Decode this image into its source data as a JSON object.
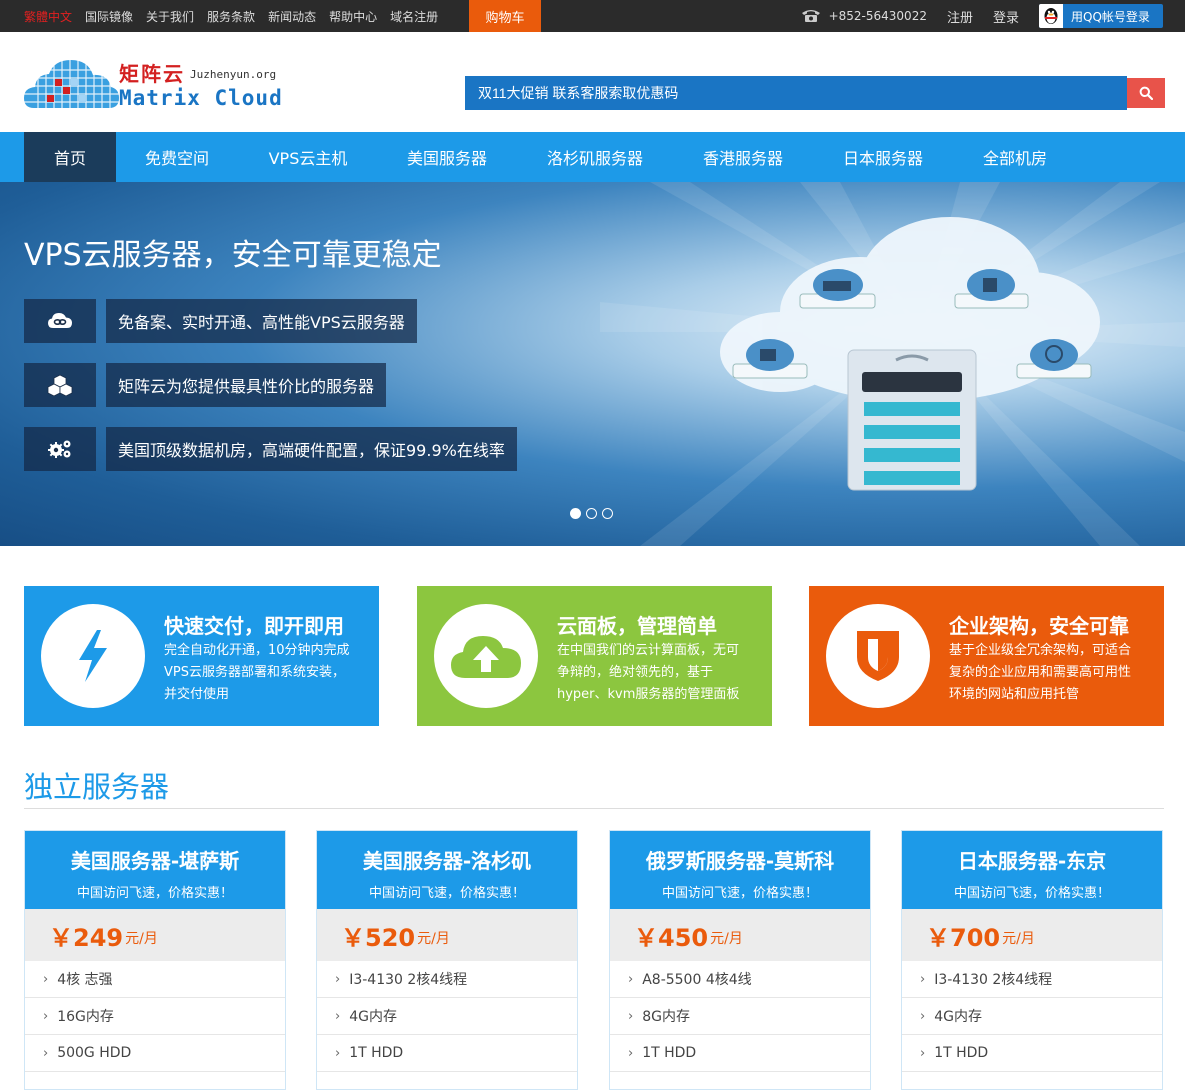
{
  "topbar": {
    "links": [
      "繁體中文",
      "国际镜像",
      "关于我们",
      "服务条款",
      "新闻动态",
      "帮助中心",
      "域名注册"
    ],
    "cart": "购物车",
    "phone": "+852-56430022",
    "register": "注册",
    "login": "登录",
    "qq_login": "用QQ帐号登录"
  },
  "logo": {
    "cn": "矩阵云",
    "domain": "Juzhenyun.org",
    "en": "Matrix Cloud"
  },
  "search": {
    "value": "双11大促销 联系客服索取优惠码"
  },
  "nav": {
    "items": [
      "首页",
      "免费空间",
      "VPS云主机",
      "美国服务器",
      "洛杉矶服务器",
      "香港服务器",
      "日本服务器",
      "全部机房"
    ]
  },
  "banner": {
    "title": "VPS云服务器，安全可靠更稳定",
    "features": [
      {
        "text": "免备案、实时开通、高性能VPS云服务器",
        "icon": "cloud-link-icon"
      },
      {
        "text": "矩阵云为您提供最具性价比的服务器",
        "icon": "cubes-icon"
      },
      {
        "text": "美国顶级数据机房，高端硬件配置，保证99.9%在线率",
        "icon": "gears-icon"
      }
    ],
    "active_slide": 1,
    "slides": 3
  },
  "boxes": [
    {
      "title": "快速交付，即开即用",
      "text": "完全自动化开通，10分钟内完成VPS云服务器部署和系统安装，并交付使用",
      "color": "#1d9ae8",
      "icon": "lightning-icon"
    },
    {
      "title": "云面板，管理简单",
      "text": "在中国我们的云计算面板，无可争辩的，绝对领先的，基于hyper、kvm服务器的管理面板",
      "color": "#8cc63f",
      "icon": "cloud-upload-icon"
    },
    {
      "title": "企业架构，安全可靠",
      "text": "基于企业级全冗余架构，可适合复杂的企业应用和需要高可用性环境的网站和应用托管",
      "color": "#ea5b0c",
      "icon": "shield-icon"
    }
  ],
  "section": {
    "title": "独立服务器"
  },
  "cards": [
    {
      "title": "美国服务器-堪萨斯",
      "subtitle": "中国访问飞速，价格实惠！",
      "price": "￥249",
      "unit": "元/月",
      "specs": [
        "4核 志强",
        "16G内存",
        "500G HDD"
      ]
    },
    {
      "title": "美国服务器-洛杉矶",
      "subtitle": "中国访问飞速，价格实惠！",
      "price": "￥520",
      "unit": "元/月",
      "specs": [
        "I3-4130 2核4线程",
        "4G内存",
        "1T HDD"
      ]
    },
    {
      "title": "俄罗斯服务器-莫斯科",
      "subtitle": "中国访问飞速，价格实惠！",
      "price": "￥450",
      "unit": "元/月",
      "specs": [
        "A8-5500 4核4线",
        "8G内存",
        "1T HDD"
      ]
    },
    {
      "title": "日本服务器-东京",
      "subtitle": "中国访问飞速，价格实惠！",
      "price": "￥700",
      "unit": "元/月",
      "specs": [
        "I3-4130 2核4线程",
        "4G内存",
        "1T HDD"
      ]
    }
  ]
}
